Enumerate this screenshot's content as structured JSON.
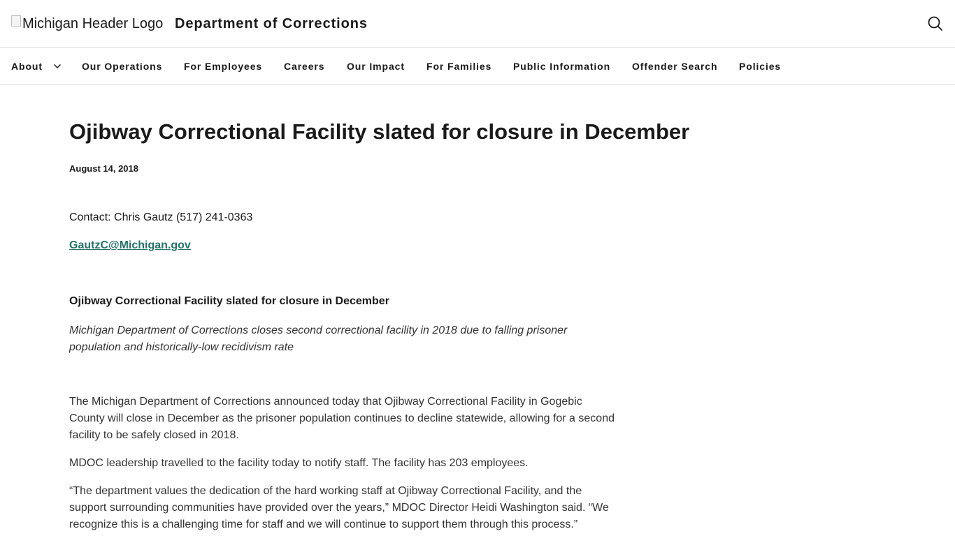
{
  "header": {
    "logo_alt": "Michigan Header Logo",
    "site_title": "Department of Corrections",
    "search_icon": "search-icon"
  },
  "nav": {
    "items": [
      {
        "label": "About",
        "has_dropdown": true
      },
      {
        "label": "Our Operations"
      },
      {
        "label": "For Employees"
      },
      {
        "label": "Careers"
      },
      {
        "label": "Our Impact"
      },
      {
        "label": "For Families"
      },
      {
        "label": "Public Information"
      },
      {
        "label": "Offender Search"
      },
      {
        "label": "Policies"
      }
    ]
  },
  "article": {
    "title": "Ojibway Correctional Facility slated for closure in December",
    "date": "August 14, 2018",
    "contact": "Contact: Chris Gautz (517) 241-0363",
    "email": "GautzC@Michigan.gov",
    "subhead": "Ojibway Correctional Facility slated for closure in December",
    "tagline": "Michigan Department of Corrections closes second correctional facility in 2018 due to falling prisoner population and historically-low recidivism rate",
    "paragraphs": [
      "The Michigan Department of Corrections announced today that Ojibway Correctional Facility in Gogebic County will close in December as the prisoner population continues to decline statewide, allowing for a second facility to be safely closed in 2018.",
      "MDOC leadership travelled to the facility today to notify staff. The facility has 203 employees.",
      "“The department values the dedication of the hard working staff at Ojibway Correctional Facility, and the support surrounding communities have provided over the years,” MDOC Director Heidi Washington said. “We recognize this is a challenging time for staff and we will continue to support them through this process.”"
    ]
  },
  "colors": {
    "link": "#25736a",
    "text": "#1a1a1a",
    "divider": "#d9d9d9"
  }
}
